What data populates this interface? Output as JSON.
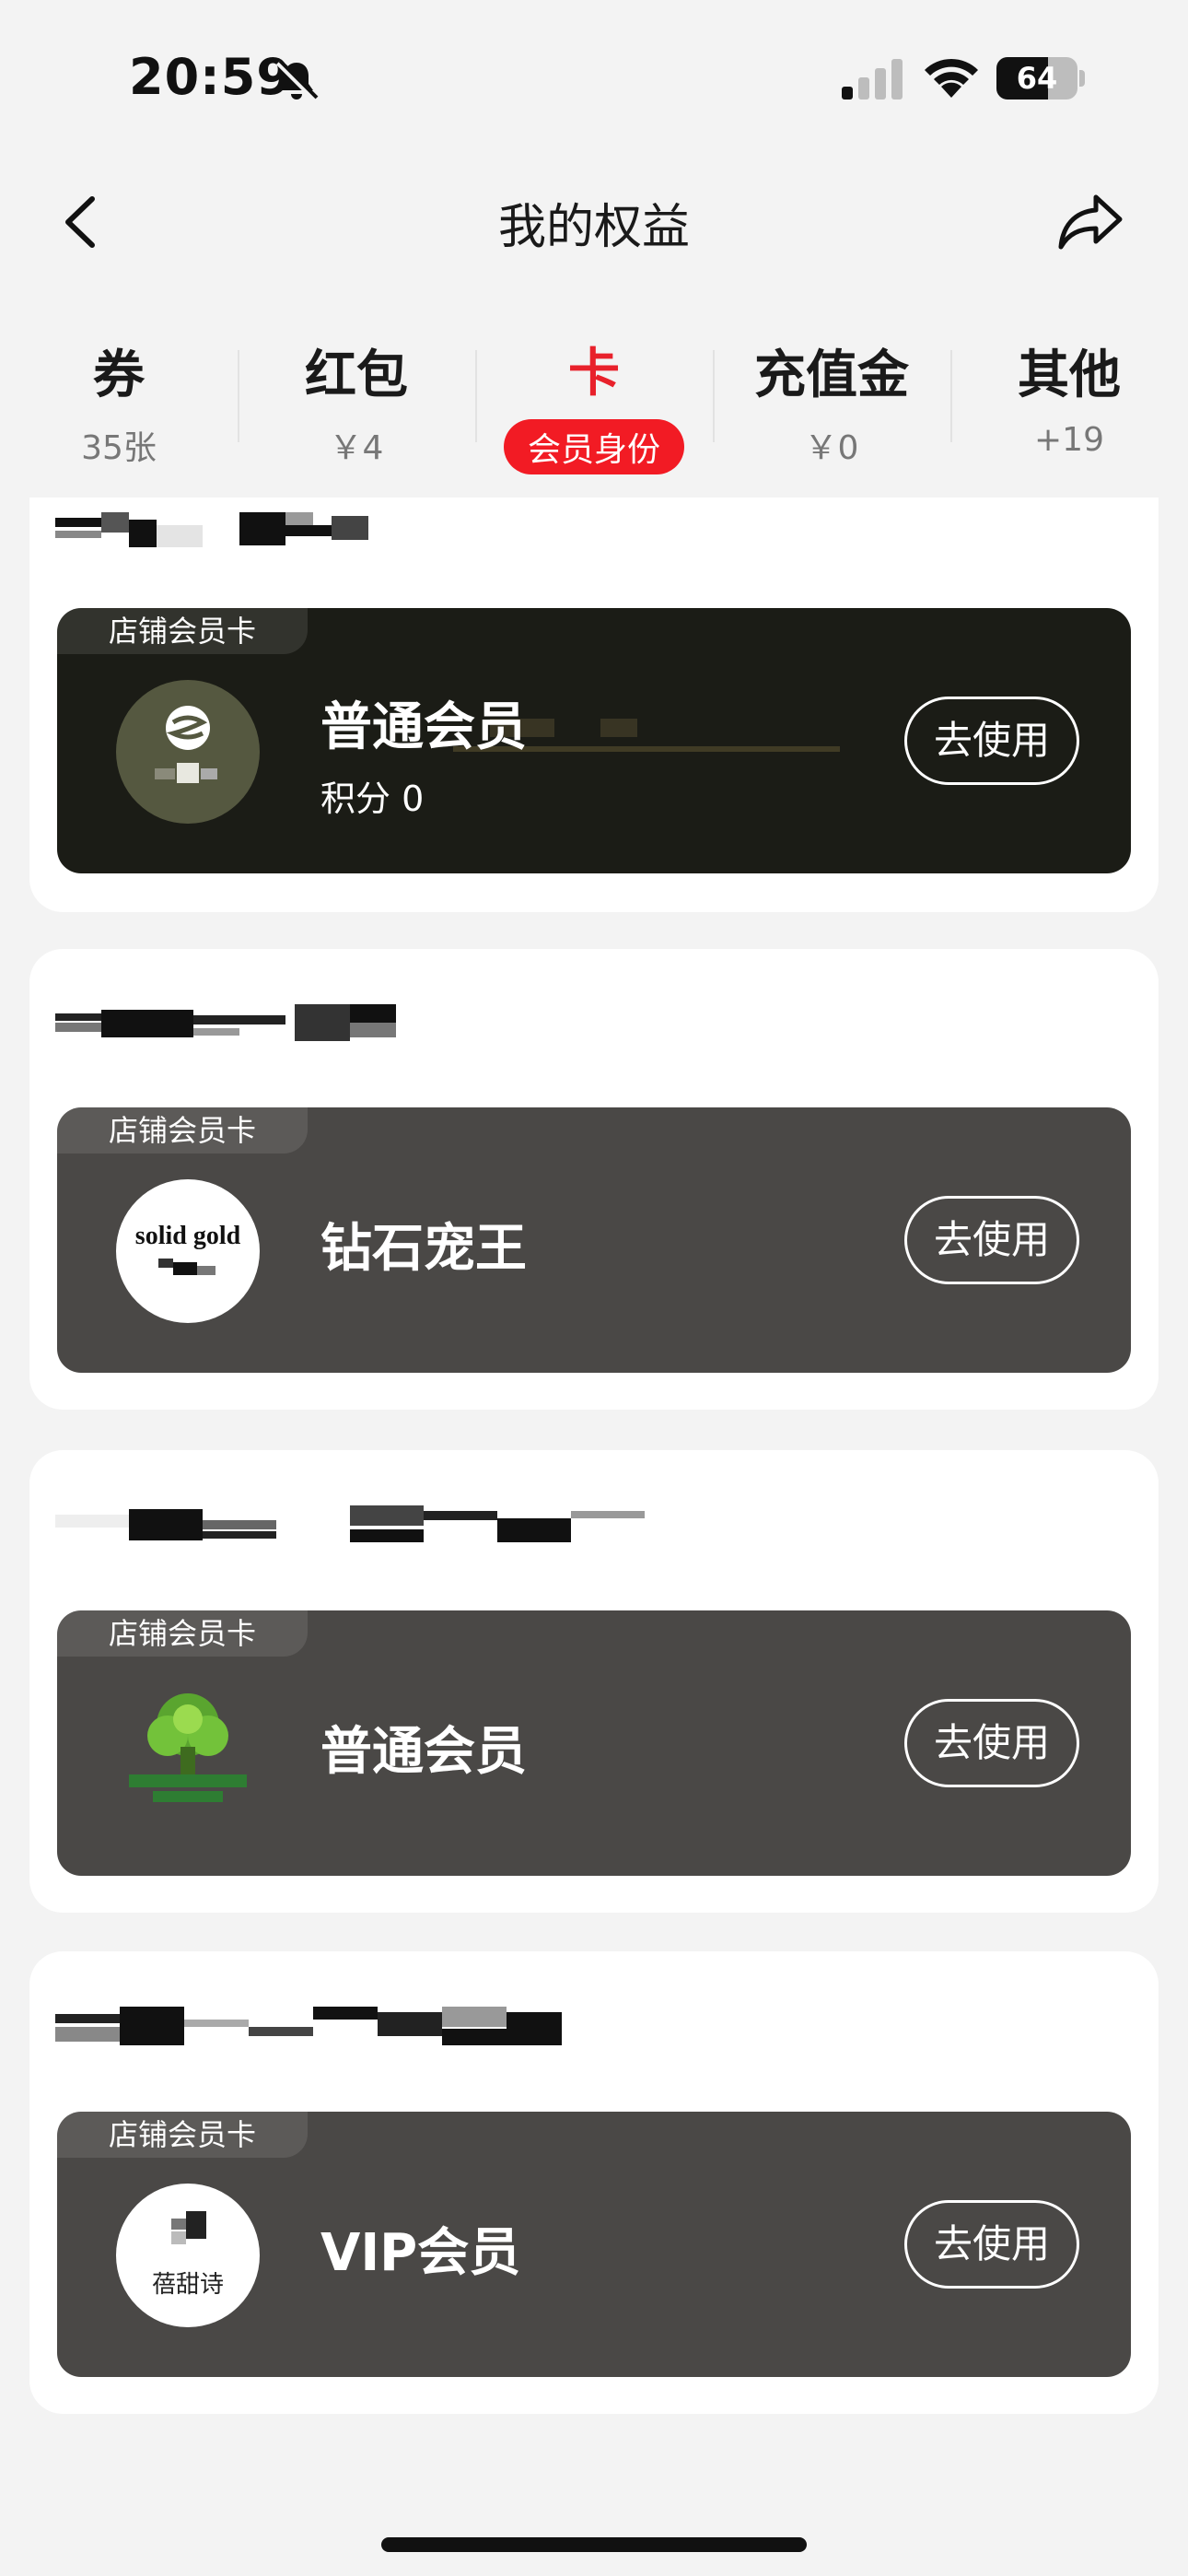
{
  "status_bar": {
    "time": "20:59",
    "battery_level": "64",
    "battery_fraction": 0.64,
    "icons": [
      "bell-slash-icon",
      "cellular-signal-icon",
      "wifi-icon",
      "battery-icon"
    ]
  },
  "nav": {
    "title": "我的权益",
    "back_icon": "chevron-left-icon",
    "share_icon": "share-arrow-icon"
  },
  "tabs": [
    {
      "label": "券",
      "sub": "35张"
    },
    {
      "label": "红包",
      "sub": "￥4"
    },
    {
      "label": "卡",
      "sub": "会员身份",
      "active": true
    },
    {
      "label": "充值金",
      "sub": "￥0"
    },
    {
      "label": "其他",
      "sub": "+19"
    }
  ],
  "colors": {
    "accent_red": "#e8212b",
    "page_bg": "#f3f3f3",
    "card_dark": "#1b1c16",
    "card_gray": "#4a4846"
  },
  "cards": [
    {
      "tag": "店铺会员卡",
      "name": "普通会员",
      "points": "积分 0",
      "button": "去使用",
      "logo": "store-logo-s",
      "theme": "dark-olive"
    },
    {
      "tag": "店铺会员卡",
      "name": "钻石宠王",
      "button": "去使用",
      "logo": "solid-gold-logo",
      "logo_text": "solid gold",
      "theme": "gray"
    },
    {
      "tag": "店铺会员卡",
      "name": "普通会员",
      "button": "去使用",
      "logo": "green-tree-logo",
      "theme": "gray"
    },
    {
      "tag": "店铺会员卡",
      "name": "VIP会员",
      "button": "去使用",
      "logo": "store-logo-text",
      "logo_text": "蓓甜诗",
      "theme": "gray"
    }
  ]
}
